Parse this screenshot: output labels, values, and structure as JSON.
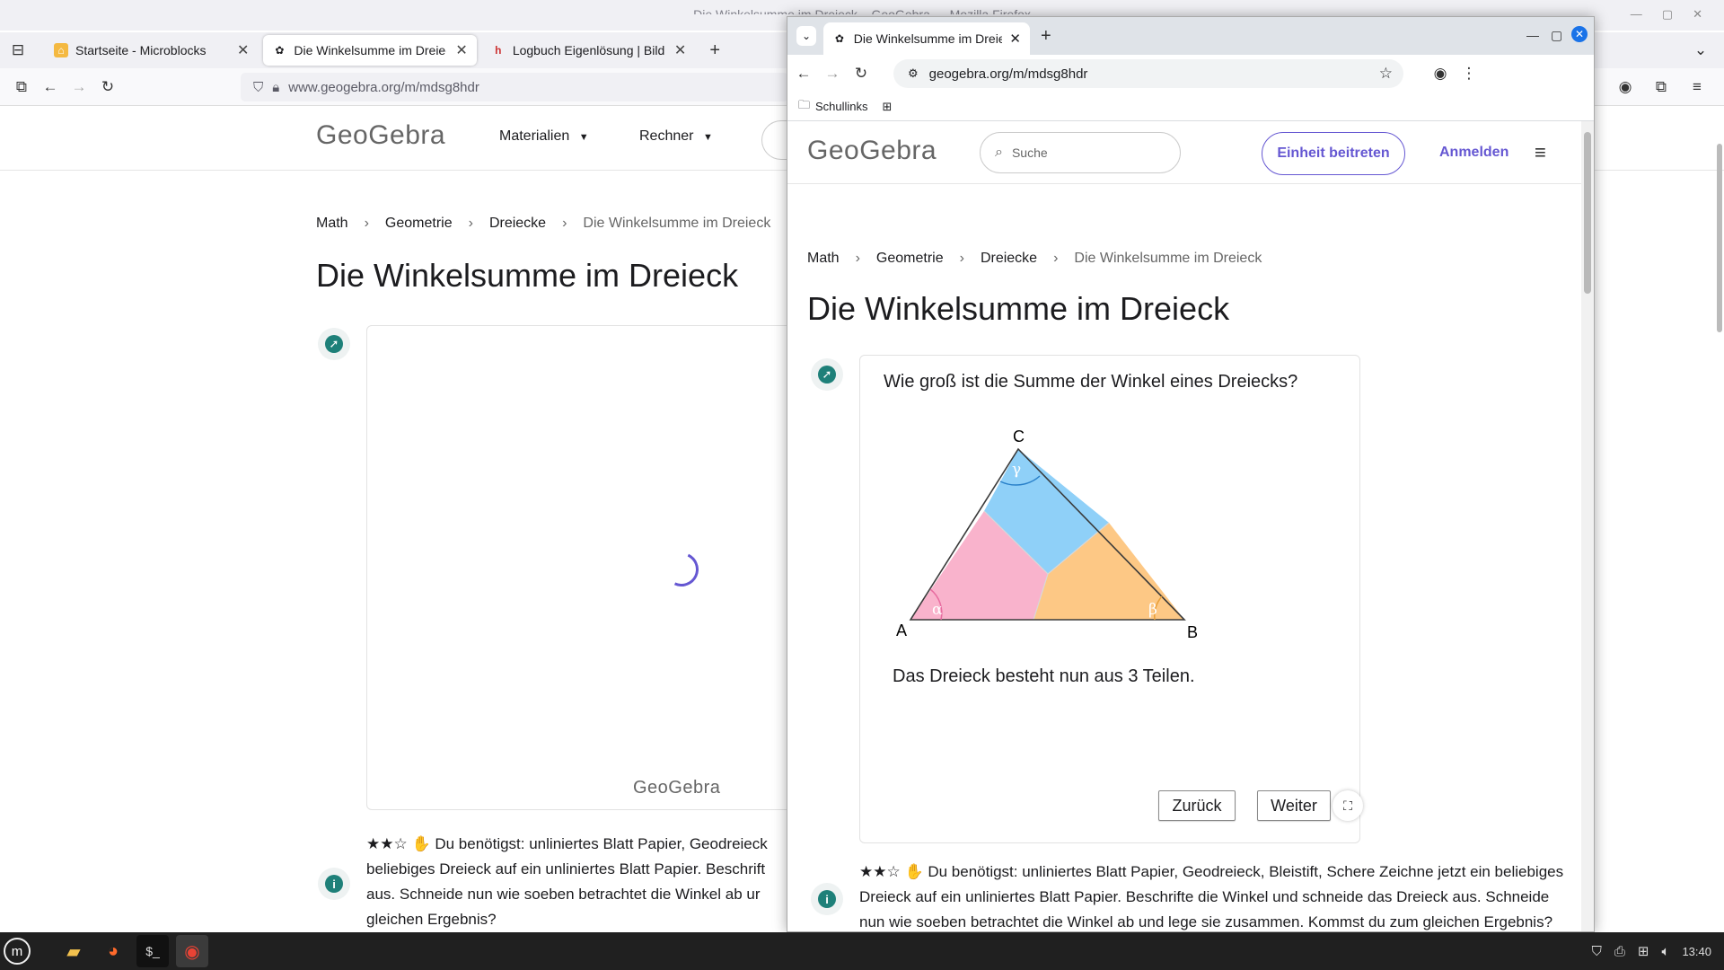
{
  "firefox": {
    "window_title": "Die Winkelsumme im Dreieck – GeoGebra — Mozilla Firefox",
    "tabs": [
      {
        "label": "Startseite - Microblocks",
        "icon": "microblocks-icon"
      },
      {
        "label": "Die Winkelsumme im Dreieck",
        "icon": "geogebra-icon"
      },
      {
        "label": "Logbuch Eigenlösung | Bildu",
        "icon": "logbuch-icon"
      }
    ],
    "url": "www.geogebra.org/m/mdsg8hdr",
    "menu_materials": "Materialien",
    "menu_calculator": "Rechner",
    "logo": "GeoGebra",
    "app_tag": "GeoGebra",
    "text": "★★☆ ✋ Du benötigst: unliniertes Blatt Papier, Geodreieck beliebiges Dreieck auf ein unliniertes Blatt Papier. Beschrift aus. Schneide nun wie soeben betrachtet die Winkel ab ur gleichen Ergebnis?"
  },
  "page": {
    "breadcrumb": [
      "Math",
      "Geometrie",
      "Dreiecke",
      "Die Winkelsumme im Dreieck"
    ],
    "title": "Die Winkelsumme im Dreieck"
  },
  "chrome": {
    "tab_label": "Die Winkelsumme im Dreieck",
    "url": "geogebra.org/m/mdsg8hdr",
    "bookmark_folder": "Schullinks",
    "search_placeholder": "Suche",
    "join_button": "Einheit beitreten",
    "login_link": "Anmelden",
    "question": "Wie groß ist die Summe der Winkel eines Dreiecks?",
    "note": "Das Dreieck besteht nun aus 3 Teilen.",
    "back_button": "Zurück",
    "next_button": "Weiter",
    "text": "★★☆ ✋ Du benötigst: unliniertes Blatt Papier, Geodreieck, Bleistift, Schere Zeichne jetzt ein beliebiges Dreieck auf ein unliniertes Blatt Papier. Beschrifte die Winkel und schneide das Dreieck aus. Schneide nun wie soeben betrachtet die Winkel ab und lege sie zusammen. Kommst du zum gleichen Ergebnis?",
    "triangle": {
      "vertex_a": "A",
      "vertex_b": "B",
      "vertex_c": "C",
      "angle_a": "α",
      "angle_b": "β",
      "angle_c": "γ",
      "colors": {
        "a": "#f9b3cc",
        "b": "#fdc885",
        "c": "#8fd0f8"
      }
    }
  },
  "taskbar": {
    "time": "13:40"
  },
  "colors": {
    "accent": "#6557d2",
    "teal": "#1e8079"
  }
}
